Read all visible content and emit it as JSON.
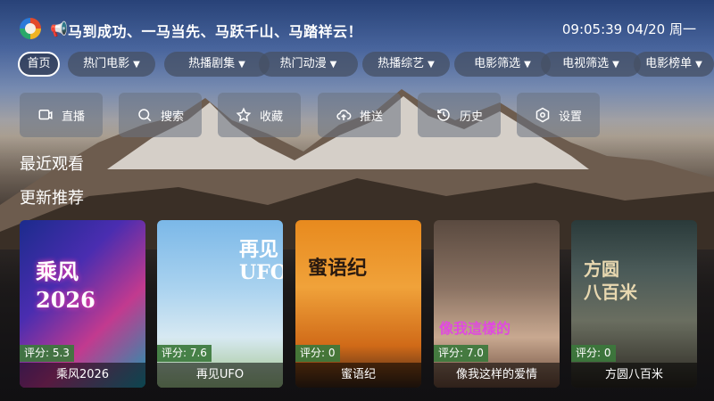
{
  "header": {
    "ticker": "马到成功、一马当先、马跃千山、马踏祥云！",
    "clock": "09:05:39 04/20 周一"
  },
  "tabs": [
    {
      "label": "首页",
      "dropdown": false,
      "active": true
    },
    {
      "label": "热门电影",
      "dropdown": true
    },
    {
      "label": "热播剧集",
      "dropdown": true
    },
    {
      "label": "热门动漫",
      "dropdown": true
    },
    {
      "label": "热播综艺",
      "dropdown": true
    },
    {
      "label": "电影筛选",
      "dropdown": true
    },
    {
      "label": "电视筛选",
      "dropdown": true
    },
    {
      "label": "电影榜单",
      "dropdown": true
    }
  ],
  "actions": [
    {
      "label": "直播",
      "icon": "tv-icon"
    },
    {
      "label": "搜索",
      "icon": "search-icon"
    },
    {
      "label": "收藏",
      "icon": "star-icon"
    },
    {
      "label": "推送",
      "icon": "upload-cloud-icon"
    },
    {
      "label": "历史",
      "icon": "history-icon"
    },
    {
      "label": "设置",
      "icon": "gear-icon"
    }
  ],
  "sections": {
    "recent": "最近观看",
    "updates": "更新推荐"
  },
  "cards": [
    {
      "title": "乘风2026",
      "rating": "评分: 5.3",
      "poster_text": "乘风\n2026"
    },
    {
      "title": "再见UFO",
      "rating": "评分: 7.6",
      "poster_text": "再见\nUFO"
    },
    {
      "title": "蜜语纪",
      "rating": "评分: 0",
      "poster_text": "蜜语纪"
    },
    {
      "title": "像我这样的爱情",
      "rating": "评分: 7.0",
      "poster_text": "像我這樣的"
    },
    {
      "title": "方圆八百米",
      "rating": "评分: 0",
      "poster_text": "方圆\n八百米"
    }
  ],
  "colors": {
    "rating_bg": "#3c783c",
    "tab_bg": "#465064",
    "action_bg": "#697382"
  }
}
